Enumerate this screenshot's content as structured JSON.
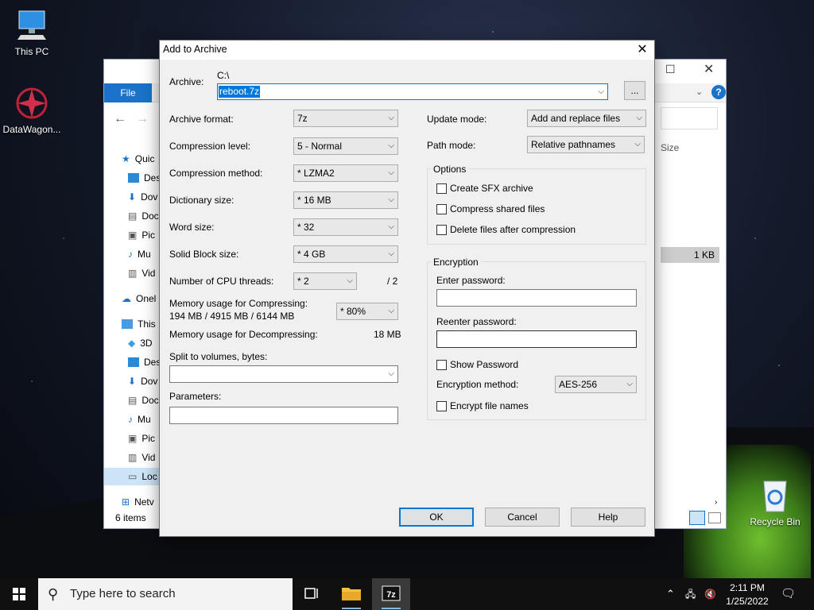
{
  "desktop": {
    "this_pc_label": "This PC",
    "datawagon_label": "DataWagon...",
    "recycle_bin_label": "Recycle Bin"
  },
  "explorer": {
    "file_tab": "File",
    "nav_items": [
      "Quic",
      "Des",
      "Dov",
      "Doc",
      "Pic",
      "Mu",
      "Vid",
      "Onel",
      "This",
      "3D",
      "Des",
      "Dov",
      "Doc",
      "Mu",
      "Pic",
      "Vid",
      "Loc",
      "Netv"
    ],
    "size_header": "Size",
    "size_value": "1 KB",
    "status": "6 items"
  },
  "dialog": {
    "title": "Add to Archive",
    "archive_label": "Archive:",
    "archive_path": "C:\\",
    "archive_name": "reboot.7z",
    "browse_label": "...",
    "format_label": "Archive format:",
    "format_value": "7z",
    "level_label": "Compression level:",
    "level_value": "5 - Normal",
    "method_label": "Compression method:",
    "method_value": "* LZMA2",
    "dict_label": "Dictionary size:",
    "dict_value": "* 16 MB",
    "word_label": "Word size:",
    "word_value": "* 32",
    "solid_label": "Solid Block size:",
    "solid_value": "* 4 GB",
    "threads_label": "Number of CPU threads:",
    "threads_value": "* 2",
    "threads_max": "/ 2",
    "mem_comp_label": "Memory usage for Compressing:",
    "mem_comp_values": "194 MB / 4915 MB / 6144 MB",
    "mem_comp_percent": "* 80%",
    "mem_decomp_label": "Memory usage for Decompressing:",
    "mem_decomp_value": "18 MB",
    "split_label": "Split to volumes, bytes:",
    "split_value": "",
    "params_label": "Parameters:",
    "params_value": "",
    "update_label": "Update mode:",
    "update_value": "Add and replace files",
    "pathmode_label": "Path mode:",
    "pathmode_value": "Relative pathnames",
    "options_title": "Options",
    "opt_sfx": "Create SFX archive",
    "opt_shared": "Compress shared files",
    "opt_delete": "Delete files after compression",
    "enc_title": "Encryption",
    "enter_pw_label": "Enter password:",
    "reenter_pw_label": "Reenter password:",
    "show_pw": "Show Password",
    "enc_method_label": "Encryption method:",
    "enc_method_value": "AES-256",
    "enc_names": "Encrypt file names",
    "ok": "OK",
    "cancel": "Cancel",
    "help": "Help"
  },
  "taskbar": {
    "search_placeholder": "Type here to search",
    "time": "2:11 PM",
    "date": "1/25/2022"
  }
}
